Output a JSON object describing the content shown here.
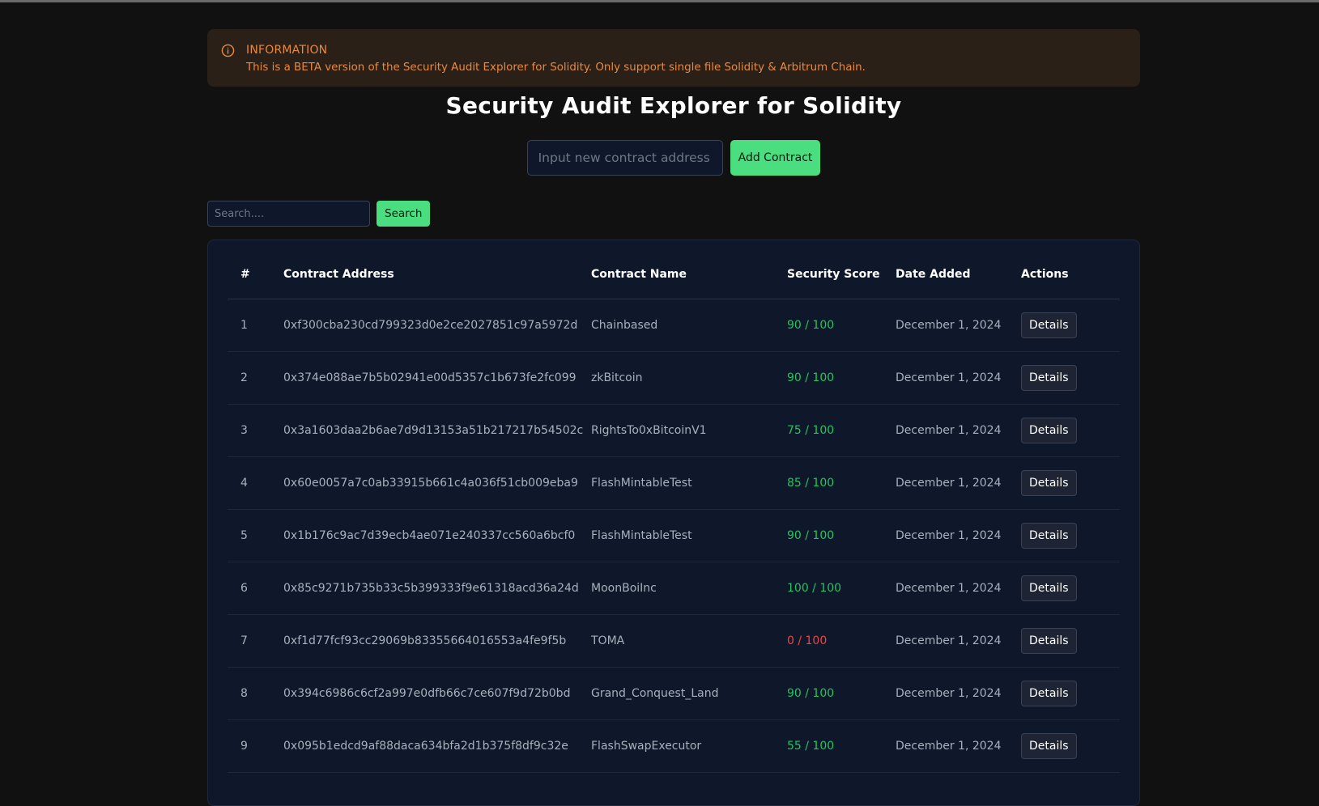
{
  "alert": {
    "title": "INFORMATION",
    "text": "This is a BETA version of the Security Audit Explorer for Solidity. Only support single file Solidity & Arbitrum Chain.",
    "icon": "info-icon",
    "color": "#e8893f"
  },
  "page": {
    "title": "Security Audit Explorer for Solidity"
  },
  "add_contract": {
    "placeholder": "Input new contract address",
    "button_label": "Add Contract"
  },
  "search": {
    "placeholder": "Search....",
    "button_label": "Search"
  },
  "colors": {
    "accent": "#4ade80",
    "score_good": "#22c55e",
    "score_bad": "#ef4444"
  },
  "table": {
    "headers": [
      "#",
      "Contract Address",
      "Contract Name",
      "Security Score",
      "Date Added",
      "Actions"
    ],
    "rows": [
      {
        "num": "1",
        "address": "0xf300cba230cd799323d0e2ce2027851c97a5972d",
        "name": "Chainbased",
        "score": "90 / 100",
        "status": "good",
        "date": "December 1, 2024",
        "action": "Details"
      },
      {
        "num": "2",
        "address": "0x374e088ae7b5b02941e00d5357c1b673fe2fc099",
        "name": "zkBitcoin",
        "score": "90 / 100",
        "status": "good",
        "date": "December 1, 2024",
        "action": "Details"
      },
      {
        "num": "3",
        "address": "0x3a1603daa2b6ae7d9d13153a51b217217b54502c",
        "name": "RightsTo0xBitcoinV1",
        "score": "75 / 100",
        "status": "good",
        "date": "December 1, 2024",
        "action": "Details"
      },
      {
        "num": "4",
        "address": "0x60e0057a7c0ab33915b661c4a036f51cb009eba9",
        "name": "FlashMintableTest",
        "score": "85 / 100",
        "status": "good",
        "date": "December 1, 2024",
        "action": "Details"
      },
      {
        "num": "5",
        "address": "0x1b176c9ac7d39ecb4ae071e240337cc560a6bcf0",
        "name": "FlashMintableTest",
        "score": "90 / 100",
        "status": "good",
        "date": "December 1, 2024",
        "action": "Details"
      },
      {
        "num": "6",
        "address": "0x85c9271b735b33c5b399333f9e61318acd36a24d",
        "name": "MoonBoiInc",
        "score": "100 / 100",
        "status": "good",
        "date": "December 1, 2024",
        "action": "Details"
      },
      {
        "num": "7",
        "address": "0xf1d77fcf93cc29069b83355664016553a4fe9f5b",
        "name": "TOMA",
        "score": "0 / 100",
        "status": "bad",
        "date": "December 1, 2024",
        "action": "Details"
      },
      {
        "num": "8",
        "address": "0x394c6986c6cf2a997e0dfb66c7ce607f9d72b0bd",
        "name": "Grand_Conquest_Land",
        "score": "90 / 100",
        "status": "good",
        "date": "December 1, 2024",
        "action": "Details"
      },
      {
        "num": "9",
        "address": "0x095b1edcd9af88daca634bfa2d1b375f8df9c32e",
        "name": "FlashSwapExecutor",
        "score": "55 / 100",
        "status": "good",
        "date": "December 1, 2024",
        "action": "Details"
      }
    ]
  }
}
